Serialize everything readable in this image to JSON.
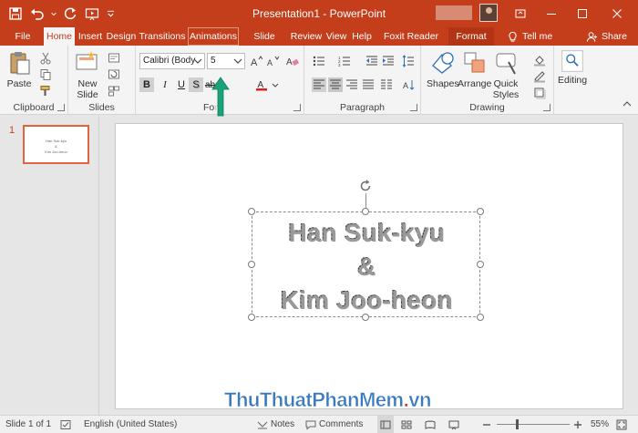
{
  "window": {
    "title": "Presentation1  -  PowerPoint"
  },
  "tabs": [
    {
      "label": "File"
    },
    {
      "label": "Home"
    },
    {
      "label": "Insert"
    },
    {
      "label": "Design"
    },
    {
      "label": "Transitions"
    },
    {
      "label": "Animations"
    },
    {
      "label": "Slide Show"
    },
    {
      "label": "Review"
    },
    {
      "label": "View"
    },
    {
      "label": "Help"
    },
    {
      "label": "Foxit Reader PDF"
    },
    {
      "label": "Format"
    }
  ],
  "tell_me": "Tell me",
  "share": "Share",
  "ribbon": {
    "clipboard": {
      "label": "Clipboard",
      "paste": "Paste"
    },
    "slides": {
      "label": "Slides",
      "new_slide_1": "New",
      "new_slide_2": "Slide"
    },
    "font": {
      "label": "Fo",
      "label_suffix": "nt",
      "family": "Calibri (Body",
      "size": "5"
    },
    "paragraph": {
      "label": "Paragraph"
    },
    "drawing": {
      "label": "Drawing",
      "shapes": "Shapes",
      "arrange": "Arrange",
      "quick_styles_1": "Quick",
      "quick_styles_2": "Styles"
    },
    "editing": {
      "label": "Editing"
    }
  },
  "thumbnail": {
    "number": "1",
    "lines": [
      "Han Suk-kyu",
      "&",
      "Kim Joo-heon"
    ]
  },
  "slide": {
    "lines": [
      "Han Suk-kyu",
      "&",
      "Kim Joo-heon"
    ]
  },
  "watermark": {
    "part1": "ThuThuatPhanMem",
    "dot": ".",
    "part2": "vn"
  },
  "status": {
    "slide": "Slide 1 of 1",
    "language": "English (United States)",
    "notes": "Notes",
    "comments": "Comments",
    "zoom": "55%",
    "zoom_level": 0.55
  },
  "colors": {
    "accent": "#c43e1c",
    "selected_thumb": "#e1643f",
    "arrow": "#1aa37a"
  }
}
